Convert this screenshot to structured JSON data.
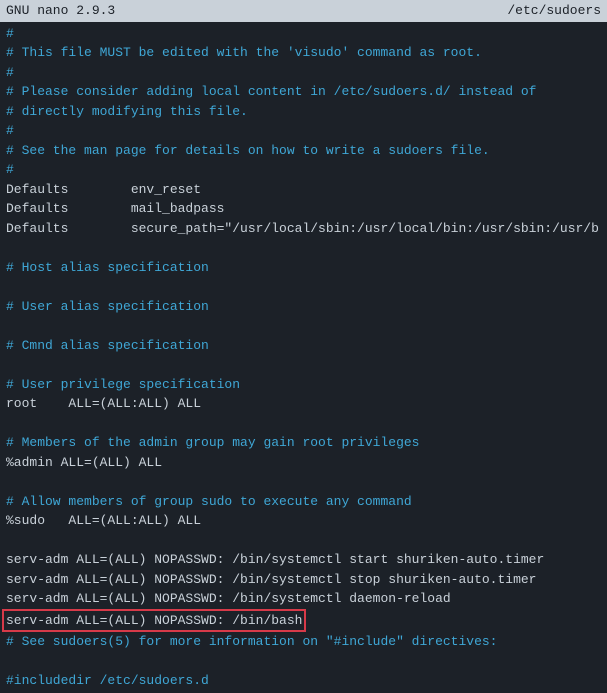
{
  "titlebar": {
    "app": "  GNU nano 2.9.3",
    "filename": "/etc/sudoers      "
  },
  "lines": [
    {
      "type": "comment",
      "text": "#"
    },
    {
      "type": "comment",
      "text": "# This file MUST be edited with the 'visudo' command as root."
    },
    {
      "type": "comment",
      "text": "#"
    },
    {
      "type": "comment",
      "text": "# Please consider adding local content in /etc/sudoers.d/ instead of"
    },
    {
      "type": "comment",
      "text": "# directly modifying this file."
    },
    {
      "type": "comment",
      "text": "#"
    },
    {
      "type": "comment",
      "text": "# See the man page for details on how to write a sudoers file."
    },
    {
      "type": "comment",
      "text": "#"
    },
    {
      "type": "plain",
      "text": "Defaults        env_reset"
    },
    {
      "type": "plain",
      "text": "Defaults        mail_badpass"
    },
    {
      "type": "plain",
      "text": "Defaults        secure_path=\"/usr/local/sbin:/usr/local/bin:/usr/sbin:/usr/b"
    },
    {
      "type": "blank",
      "text": ""
    },
    {
      "type": "comment",
      "text": "# Host alias specification"
    },
    {
      "type": "blank",
      "text": ""
    },
    {
      "type": "comment",
      "text": "# User alias specification"
    },
    {
      "type": "blank",
      "text": ""
    },
    {
      "type": "comment",
      "text": "# Cmnd alias specification"
    },
    {
      "type": "blank",
      "text": ""
    },
    {
      "type": "comment",
      "text": "# User privilege specification"
    },
    {
      "type": "plain",
      "text": "root    ALL=(ALL:ALL) ALL"
    },
    {
      "type": "blank",
      "text": ""
    },
    {
      "type": "comment",
      "text": "# Members of the admin group may gain root privileges"
    },
    {
      "type": "plain",
      "text": "%admin ALL=(ALL) ALL"
    },
    {
      "type": "blank",
      "text": ""
    },
    {
      "type": "comment",
      "text": "# Allow members of group sudo to execute any command"
    },
    {
      "type": "plain",
      "text": "%sudo   ALL=(ALL:ALL) ALL"
    },
    {
      "type": "blank",
      "text": ""
    },
    {
      "type": "plain",
      "text": "serv-adm ALL=(ALL) NOPASSWD: /bin/systemctl start shuriken-auto.timer"
    },
    {
      "type": "plain",
      "text": "serv-adm ALL=(ALL) NOPASSWD: /bin/systemctl stop shuriken-auto.timer"
    },
    {
      "type": "plain",
      "text": "serv-adm ALL=(ALL) NOPASSWD: /bin/systemctl daemon-reload"
    },
    {
      "type": "highlight",
      "text": "serv-adm ALL=(ALL) NOPASSWD: /bin/bash"
    },
    {
      "type": "comment",
      "text": "# See sudoers(5) for more information on \"#include\" directives:"
    },
    {
      "type": "blank",
      "text": ""
    },
    {
      "type": "comment",
      "text": "#includedir /etc/sudoers.d"
    }
  ]
}
